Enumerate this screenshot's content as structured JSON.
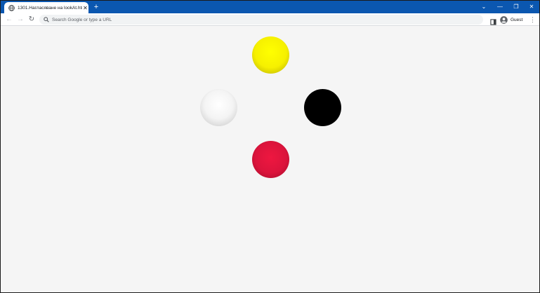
{
  "browser": {
    "tab": {
      "title": "1301.Нагласяване на lookAt.htm",
      "close_glyph": "✕",
      "favicon": "globe-icon"
    },
    "new_tab_glyph": "+",
    "window_controls": {
      "tab_search_glyph": "⌄",
      "minimize_glyph": "—",
      "restore_glyph": "❐",
      "close_glyph": "✕"
    },
    "toolbar": {
      "back_glyph": "←",
      "forward_glyph": "→",
      "reload_glyph": "↻",
      "omnibox_placeholder": "Search Google or type a URL",
      "profile_label": "Guest",
      "menu_glyph": "⋮"
    }
  },
  "scene": {
    "balls": [
      {
        "name": "yellow",
        "color": "#ffff00"
      },
      {
        "name": "white",
        "color": "#ffffff"
      },
      {
        "name": "black",
        "color": "#000000"
      },
      {
        "name": "red",
        "color": "#dc143c"
      }
    ],
    "background": "#f5f5f5"
  },
  "colors": {
    "titlebar": "#0b57b0",
    "toolbar": "#ffffff",
    "omnibox": "#f1f3f4"
  }
}
